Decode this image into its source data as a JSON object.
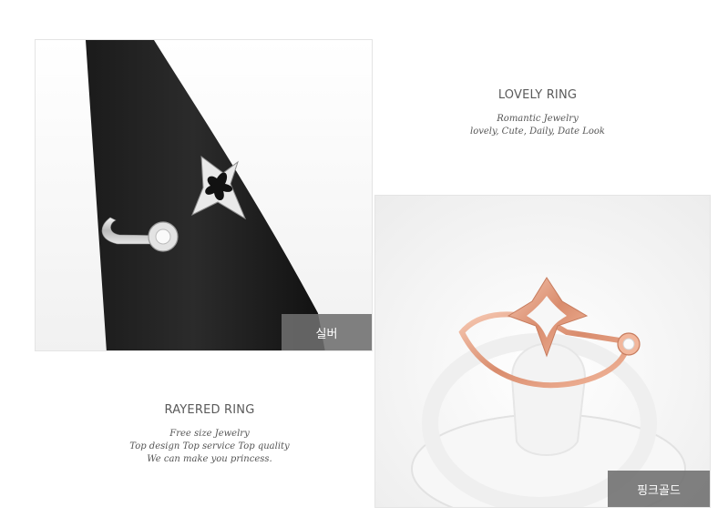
{
  "product_silver": {
    "option_label": "실버"
  },
  "product_rose": {
    "option_label": "핑크골드"
  },
  "caption_lovely": {
    "title": "LOVELY RING",
    "lines": [
      "Romantic Jewelry",
      "lovely, Cute, Daily, Date Look"
    ]
  },
  "caption_rayered": {
    "title": "RAYERED RING",
    "lines": [
      "Free size Jewelry",
      "Top design Top service Top quality",
      "We can make you princess."
    ]
  }
}
